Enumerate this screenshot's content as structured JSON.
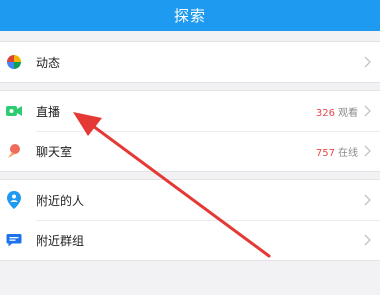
{
  "header": {
    "title": "探索"
  },
  "groups": [
    {
      "items": [
        {
          "label": "动态",
          "icon": "pinwheel-icon"
        }
      ]
    },
    {
      "items": [
        {
          "label": "直播",
          "icon": "video-camera-icon",
          "count": "326",
          "suffix": "观看"
        },
        {
          "label": "聊天室",
          "icon": "ice-cream-icon",
          "count": "757",
          "suffix": "在线"
        }
      ]
    },
    {
      "items": [
        {
          "label": "附近的人",
          "icon": "location-pin-icon"
        },
        {
          "label": "附近群组",
          "icon": "chat-bubble-icon"
        }
      ]
    }
  ],
  "annotation": {
    "type": "arrow",
    "color": "#e53935",
    "points_to": "直播"
  },
  "colors": {
    "accent": "#1e9bf0",
    "count": "#e5484d"
  }
}
